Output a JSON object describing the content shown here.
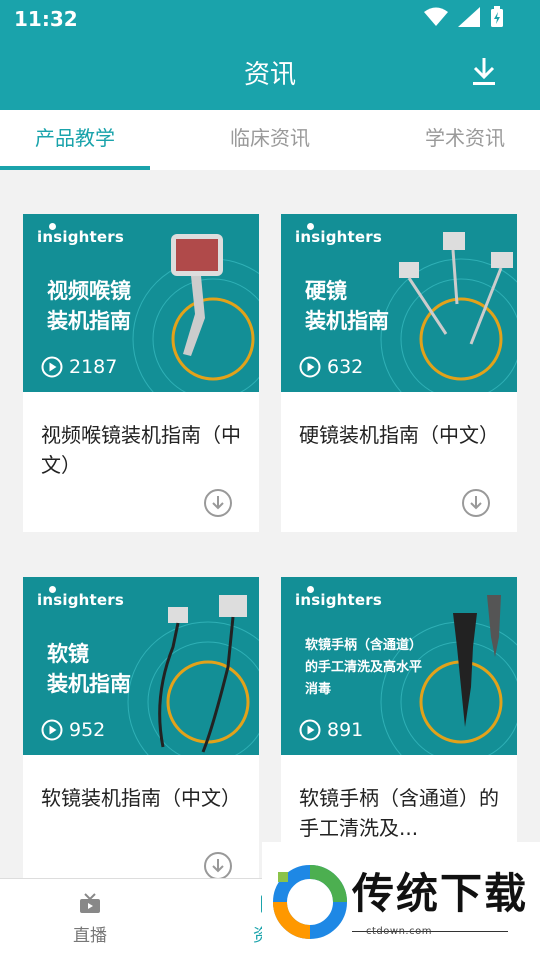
{
  "status": {
    "time": "11:32"
  },
  "header": {
    "title": "资讯"
  },
  "tabs": [
    {
      "label": "产品教学",
      "active": true
    },
    {
      "label": "临床资讯",
      "active": false
    },
    {
      "label": "学术资讯",
      "active": false
    }
  ],
  "cards": [
    {
      "brand": "insighters",
      "thumb_title": "视频喉镜\n装机指南",
      "views": "2187",
      "title": "视频喉镜装机指南（中文）"
    },
    {
      "brand": "insighters",
      "thumb_title": "硬镜\n装机指南",
      "views": "632",
      "title": "硬镜装机指南（中文）"
    },
    {
      "brand": "insighters",
      "thumb_title": "软镜\n装机指南",
      "views": "952",
      "title": "软镜装机指南（中文）"
    },
    {
      "brand": "insighters",
      "thumb_title": "软镜手柄（含通道）\n的手工清洗及高水平\n消毒",
      "views": "891",
      "title": "软镜手柄（含通道）的手工清洗及..."
    }
  ],
  "bottom_nav": [
    {
      "label": "直播",
      "icon": "tv-icon"
    },
    {
      "label": "资讯",
      "icon": "news-icon"
    }
  ],
  "watermark": {
    "text": "传统下载",
    "sub": "ctdown.com"
  },
  "colors": {
    "accent": "#1aa3ab",
    "thumb_bg": "#138f96",
    "ring": "#e2a21a"
  }
}
